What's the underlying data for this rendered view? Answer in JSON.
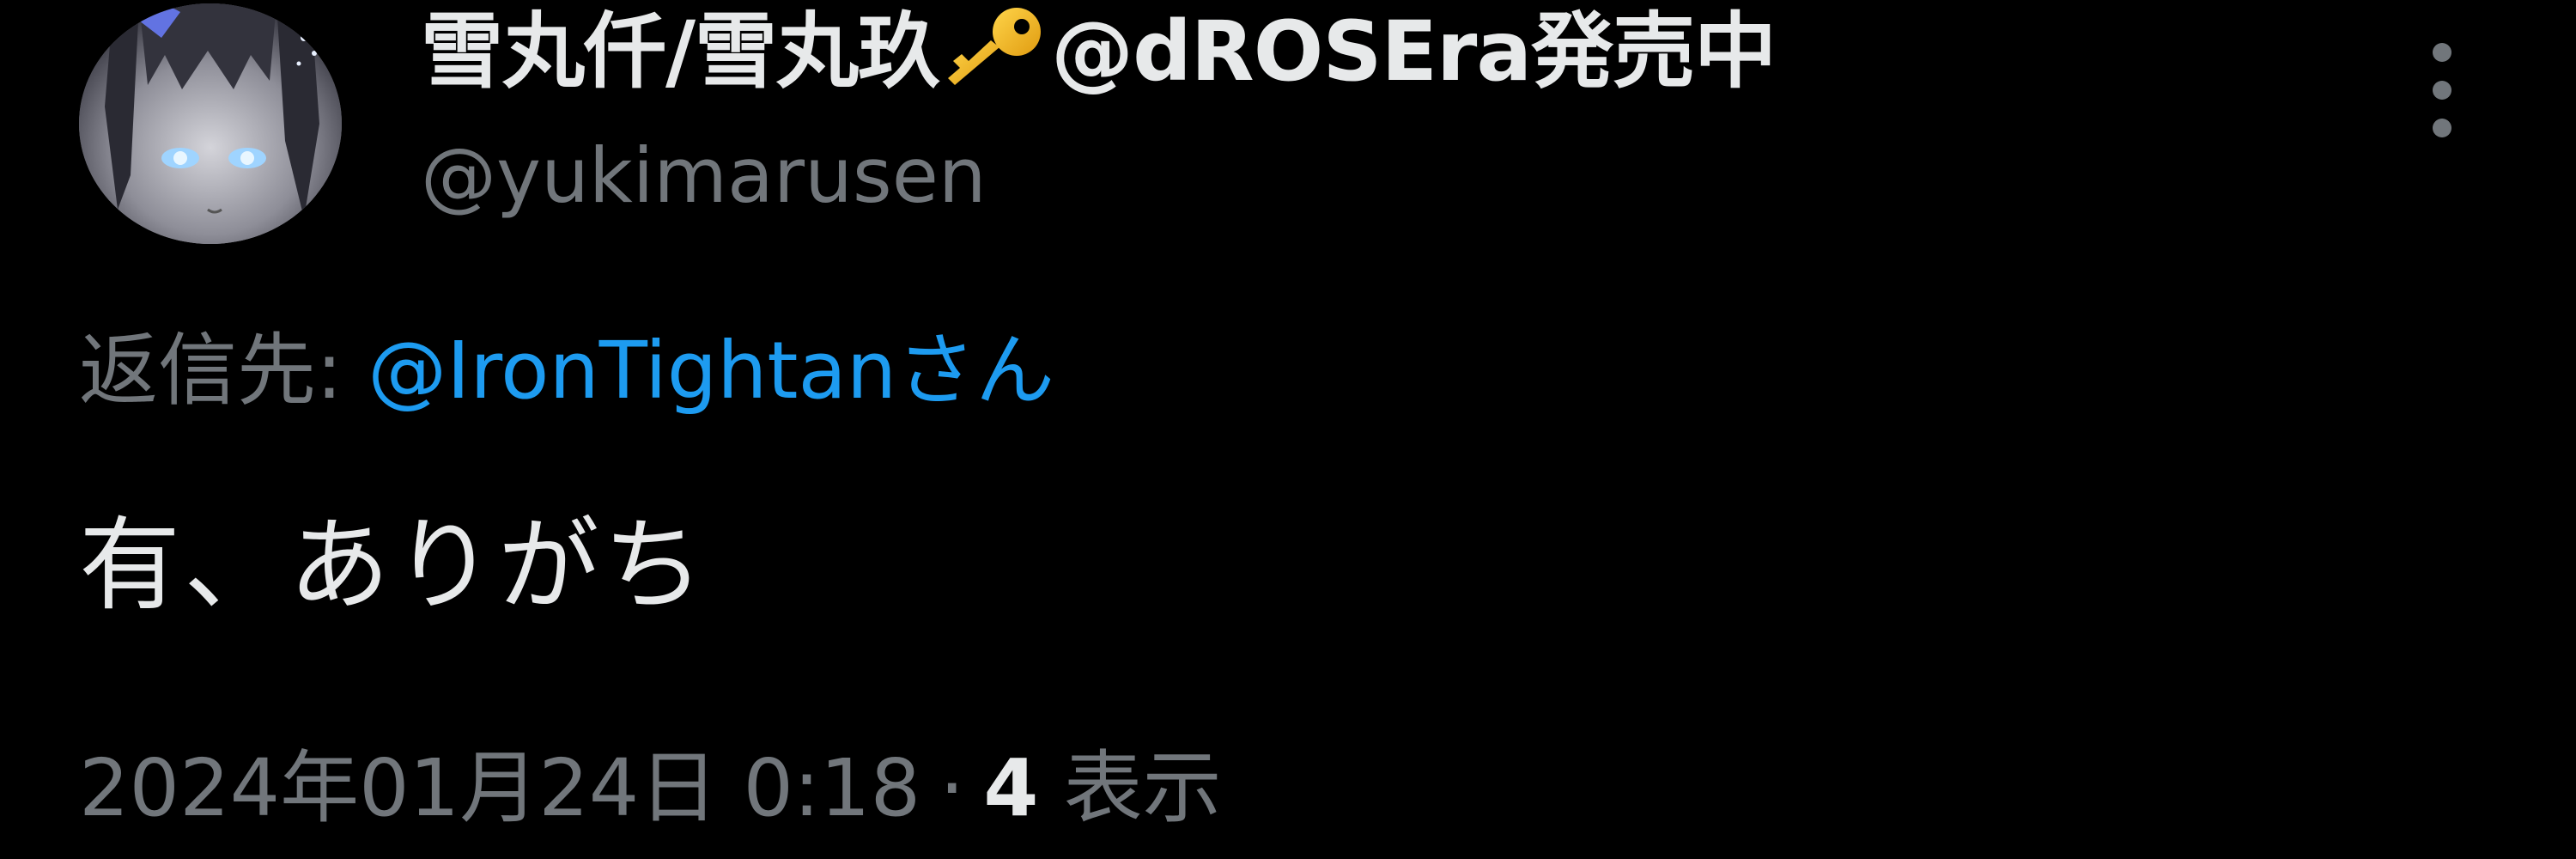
{
  "tweet": {
    "author": {
      "name_part1": "雪丸仟/雪丸玖",
      "key_emoji": "key-icon",
      "name_part2": "@dROSEra発売中",
      "handle": "@yukimarusen",
      "avatar": "avatar-illustration"
    },
    "reply": {
      "prefix": "返信先: ",
      "mention": "@IronTightanさん"
    },
    "text": "有、ありがち",
    "meta": {
      "datetime": "2024年01月24日 0:18",
      "separator": "·",
      "views_count": "4",
      "views_label": "表示"
    },
    "more_icon": "more-vertical-icon"
  },
  "colors": {
    "background": "#000000",
    "primary_text": "#e7e9ea",
    "secondary_text": "#71767b",
    "link": "#1d9bf0"
  }
}
